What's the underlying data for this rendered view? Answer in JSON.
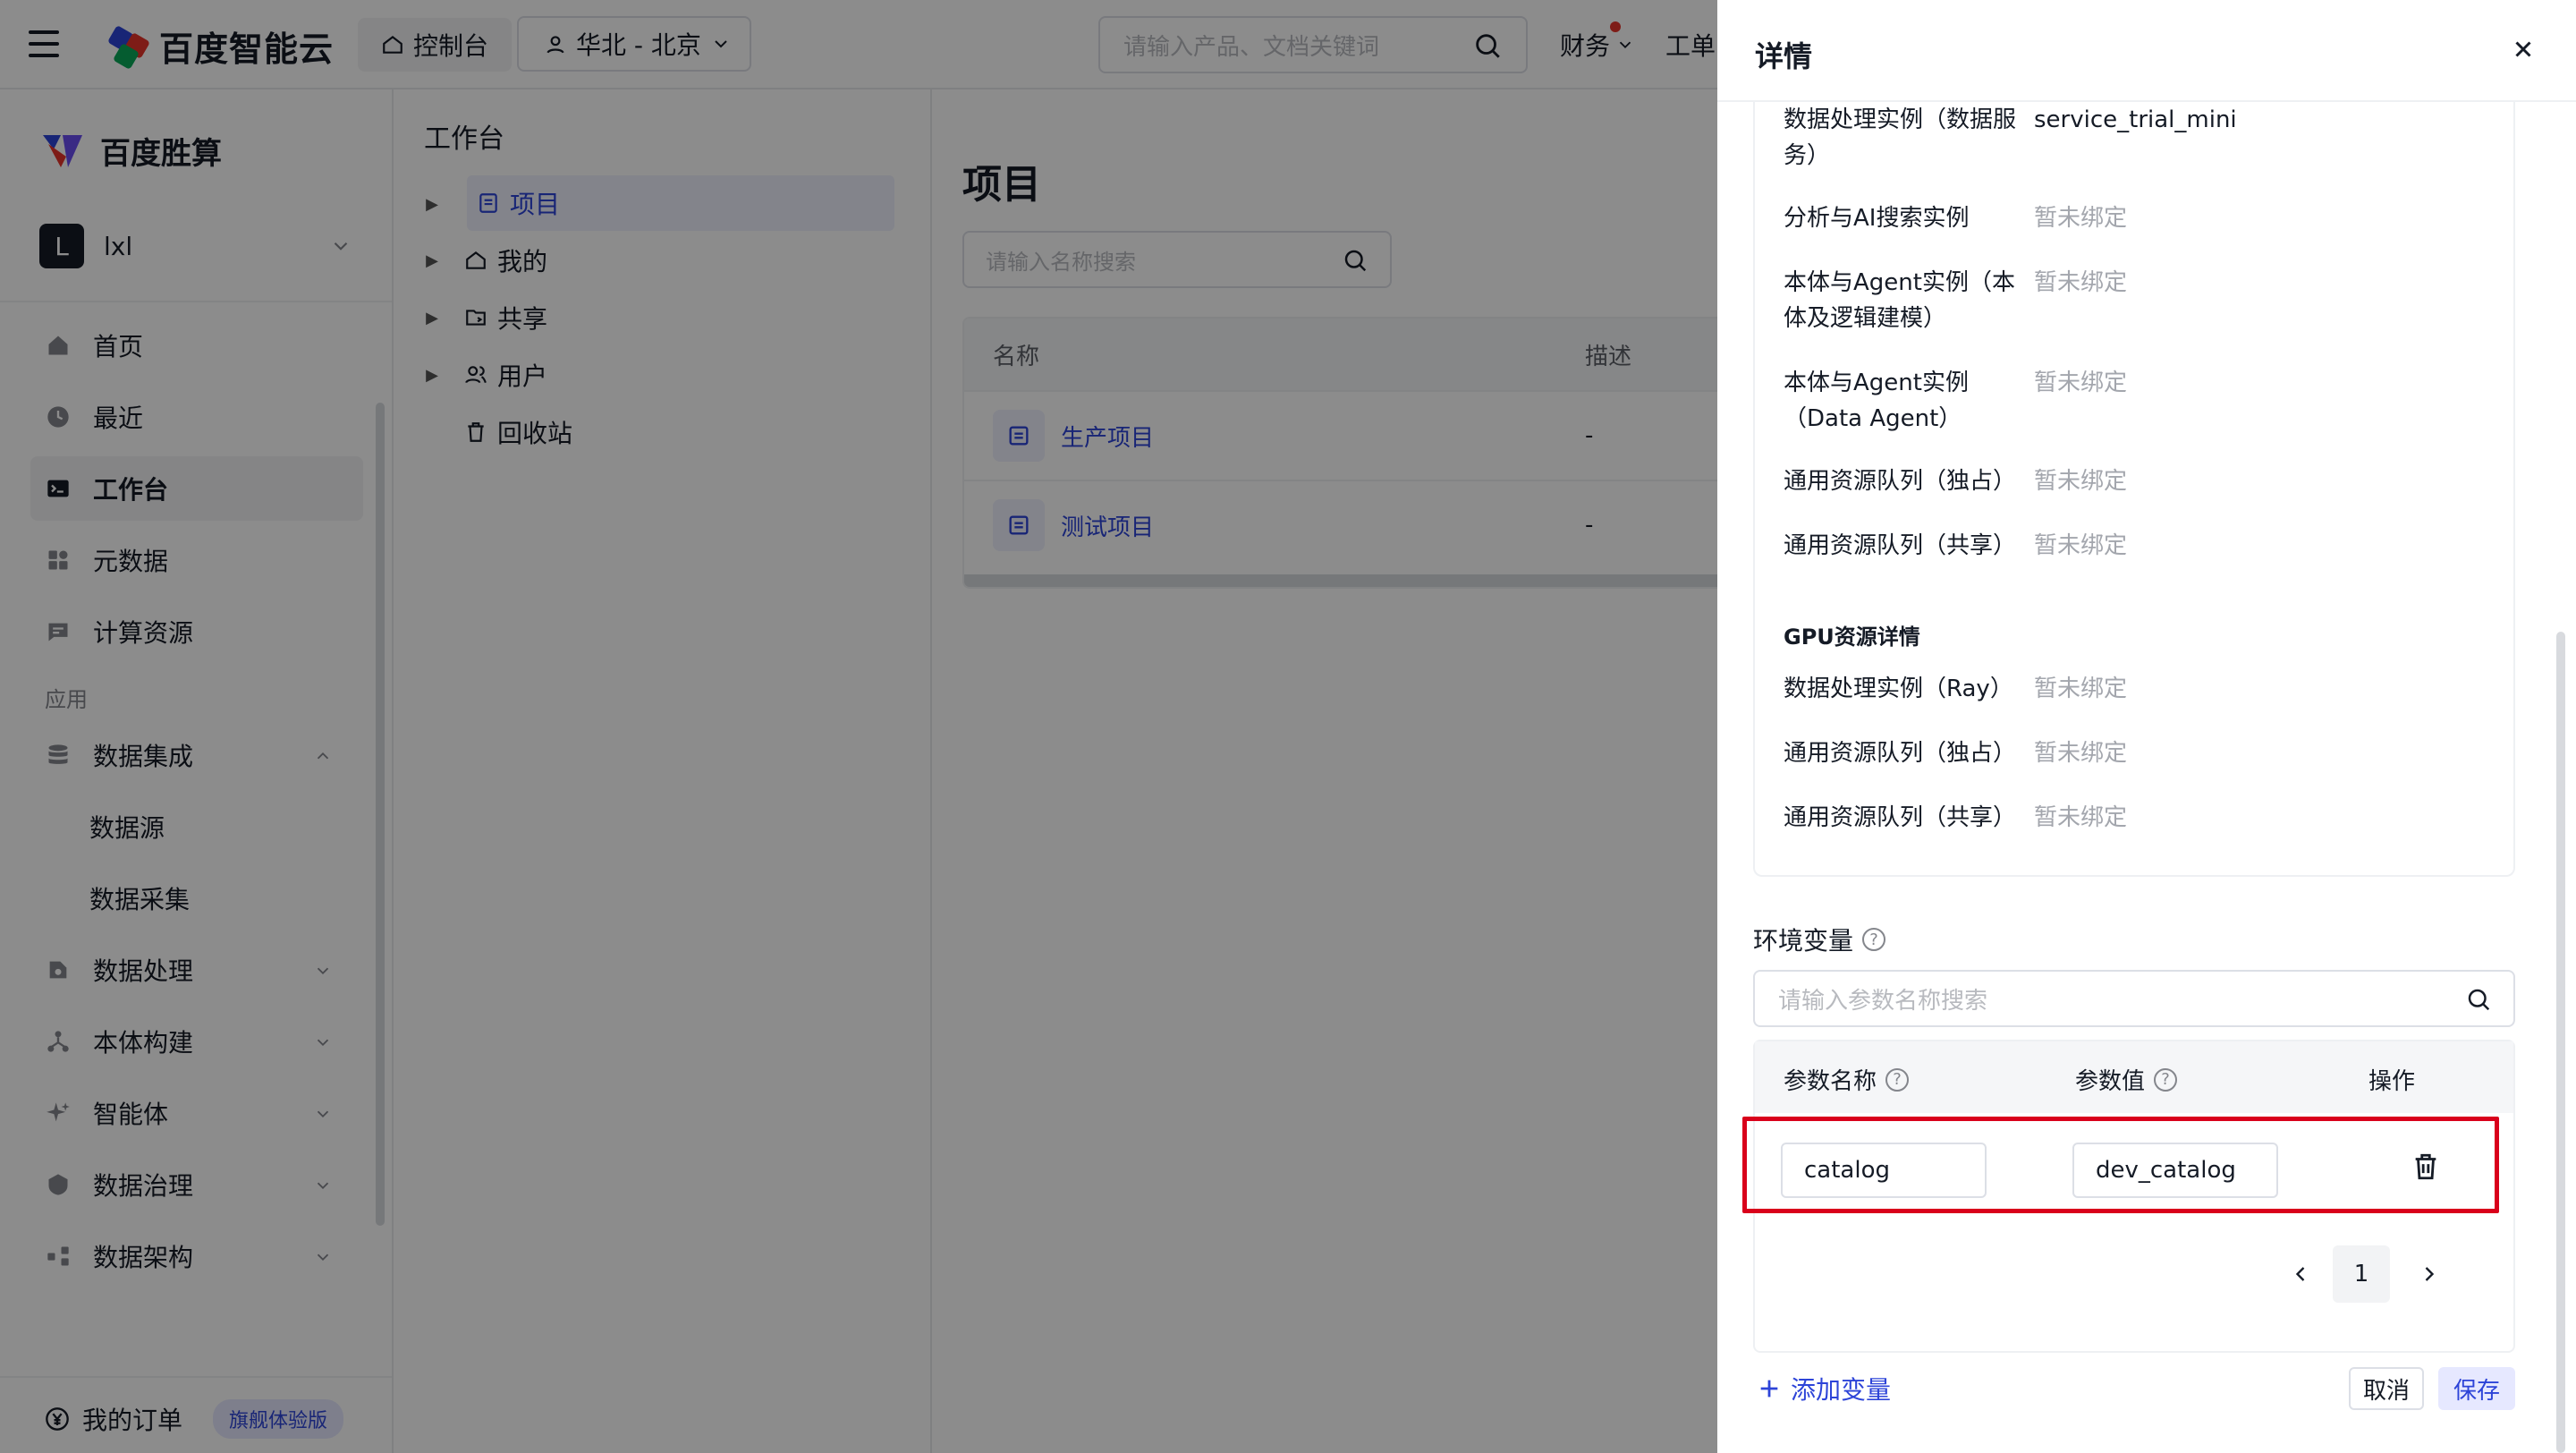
{
  "topbar": {
    "brand": "百度智能云",
    "console": "控制台",
    "region": "华北 - 北京",
    "search_placeholder": "请输入产品、文档关键词",
    "finance": "财务",
    "workorder": "工单"
  },
  "sidebar": {
    "brand": "百度胜算",
    "user_initial": "L",
    "user_name": "lxl",
    "items": [
      {
        "label": "首页",
        "icon": "home-icon"
      },
      {
        "label": "最近",
        "icon": "clock-icon"
      },
      {
        "label": "工作台",
        "icon": "terminal-icon",
        "active": true
      },
      {
        "label": "元数据",
        "icon": "grid-icon"
      },
      {
        "label": "计算资源",
        "icon": "message-icon"
      }
    ],
    "group_label": "应用",
    "apps": [
      {
        "label": "数据集成",
        "icon": "database-icon",
        "expanded": true
      },
      {
        "label": "数据源",
        "sub": true
      },
      {
        "label": "数据采集",
        "sub": true
      },
      {
        "label": "数据处理",
        "icon": "process-icon"
      },
      {
        "label": "本体构建",
        "icon": "nodes-icon"
      },
      {
        "label": "智能体",
        "icon": "sparkle-icon"
      },
      {
        "label": "数据治理",
        "icon": "shield-icon"
      },
      {
        "label": "数据架构",
        "icon": "architecture-icon"
      }
    ],
    "order_label": "我的订单",
    "order_badge": "旗舰体验版"
  },
  "workspace": {
    "title": "工作台",
    "tree": [
      {
        "label": "项目",
        "active": true
      },
      {
        "label": "我的"
      },
      {
        "label": "共享"
      },
      {
        "label": "用户"
      },
      {
        "label": "回收站"
      }
    ]
  },
  "main": {
    "title": "项目",
    "search_placeholder": "请输入名称搜索",
    "columns": [
      "名称",
      "描述"
    ],
    "rows": [
      {
        "name": "生产项目",
        "desc": "-"
      },
      {
        "name": "测试项目",
        "desc": "-"
      }
    ]
  },
  "drawer": {
    "title": "详情",
    "instances": [
      {
        "k": "数据处理实例（数据服务）",
        "v": "service_trial_mini",
        "muted": false
      },
      {
        "k": "分析与AI搜索实例",
        "v": "暂未绑定",
        "muted": true
      },
      {
        "k": "本体与Agent实例（本体及逻辑建模）",
        "v": "暂未绑定",
        "muted": true
      },
      {
        "k": "本体与Agent实例（Data Agent）",
        "v": "暂未绑定",
        "muted": true
      },
      {
        "k": "通用资源队列（独占）",
        "v": "暂未绑定",
        "muted": true
      },
      {
        "k": "通用资源队列（共享）",
        "v": "暂未绑定",
        "muted": true
      }
    ],
    "gpu_title": "GPU资源详情",
    "gpu": [
      {
        "k": "数据处理实例（Ray）",
        "v": "暂未绑定"
      },
      {
        "k": "通用资源队列（独占）",
        "v": "暂未绑定"
      },
      {
        "k": "通用资源队列（共享）",
        "v": "暂未绑定"
      }
    ],
    "env_label": "环境变量",
    "env_search_placeholder": "请输入参数名称搜索",
    "env_columns": {
      "name": "参数名称",
      "value": "参数值",
      "op": "操作"
    },
    "env_row": {
      "name": "catalog",
      "value": "dev_catalog"
    },
    "page": "1",
    "add_var": "添加变量",
    "cancel": "取消",
    "save": "保存"
  }
}
